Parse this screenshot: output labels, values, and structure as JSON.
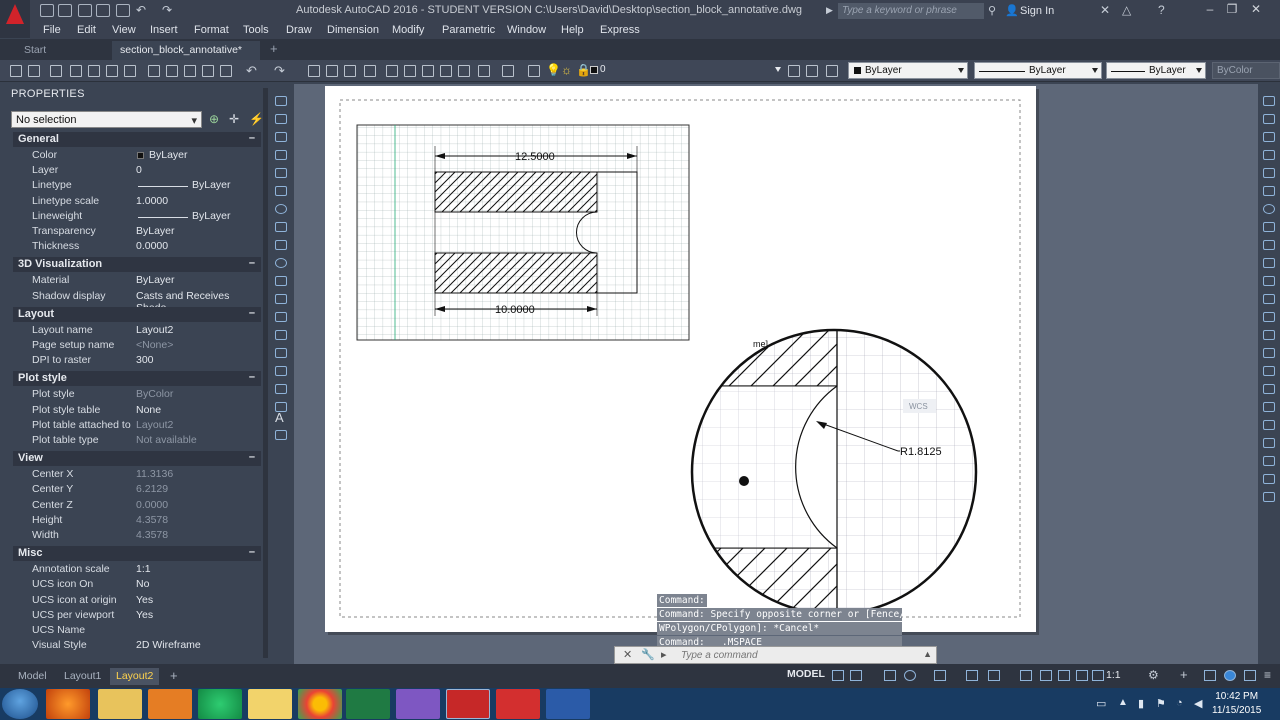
{
  "title_bar": {
    "title": "Autodesk AutoCAD 2016 - STUDENT VERSION    C:\\Users\\David\\Desktop\\section_block_annotative.dwg",
    "search_placeholder": "Type a keyword or phrase",
    "sign_in": "Sign In"
  },
  "menu": [
    "File",
    "Edit",
    "View",
    "Insert",
    "Format",
    "Tools",
    "Draw",
    "Dimension",
    "Modify",
    "Parametric",
    "Window",
    "Help",
    "Express"
  ],
  "doc_tabs": {
    "start": "Start",
    "active": "section_block_annotative*",
    "add": "+"
  },
  "toolbar": {
    "layer": "0",
    "color": "ByLayer",
    "linetype": "ByLayer",
    "lineweight": "ByLayer",
    "plotstyle": "ByColor"
  },
  "properties": {
    "title": "PROPERTIES",
    "selection": "No selection",
    "sections": [
      {
        "name": "General",
        "rows": [
          [
            "Color",
            "ByLayer"
          ],
          [
            "Layer",
            "0"
          ],
          [
            "Linetype",
            "ByLayer"
          ],
          [
            "Linetype scale",
            "1.0000"
          ],
          [
            "Lineweight",
            "ByLayer"
          ],
          [
            "Transparency",
            "ByLayer"
          ],
          [
            "Thickness",
            "0.0000"
          ]
        ]
      },
      {
        "name": "3D Visualization",
        "rows": [
          [
            "Material",
            "ByLayer"
          ],
          [
            "Shadow display",
            "Casts and Receives Shado..."
          ]
        ]
      },
      {
        "name": "Layout",
        "rows": [
          [
            "Layout name",
            "Layout2"
          ],
          [
            "Page setup name",
            "<None>"
          ],
          [
            "DPI to raster",
            "300"
          ]
        ]
      },
      {
        "name": "Plot style",
        "rows": [
          [
            "Plot style",
            "ByColor"
          ],
          [
            "Plot style table",
            "None"
          ],
          [
            "Plot table attached to",
            "Layout2"
          ],
          [
            "Plot table type",
            "Not available"
          ]
        ]
      },
      {
        "name": "View",
        "rows": [
          [
            "Center X",
            "11.3136"
          ],
          [
            "Center Y",
            "6.2129"
          ],
          [
            "Center Z",
            "0.0000"
          ],
          [
            "Height",
            "4.3578"
          ],
          [
            "Width",
            "4.3578"
          ]
        ]
      },
      {
        "name": "Misc",
        "rows": [
          [
            "Annotation scale",
            "1:1"
          ],
          [
            "UCS icon On",
            "No"
          ],
          [
            "UCS icon at origin",
            "Yes"
          ],
          [
            "UCS per viewport",
            "Yes"
          ],
          [
            "UCS Name",
            ""
          ],
          [
            "Visual Style",
            "2D Wireframe"
          ]
        ]
      }
    ]
  },
  "drawing": {
    "dim_top": "12.5000",
    "dim_bottom": "10.0000",
    "radius": "R1.8125",
    "wcs": "WCS",
    "clipped": "me]"
  },
  "command": {
    "history": [
      "Command:",
      "Command: Specify opposite corner or [Fence/",
      "WPolygon/CPolygon]: *Cancel*",
      "Command:  _.MSPACE"
    ],
    "placeholder": "Type a command"
  },
  "status": {
    "layouts": [
      "Model",
      "Layout1",
      "Layout2"
    ],
    "add": "+",
    "model": "MODEL",
    "scale": "1:1"
  },
  "clock": {
    "time": "10:42 PM",
    "date": "11/15/2015"
  }
}
